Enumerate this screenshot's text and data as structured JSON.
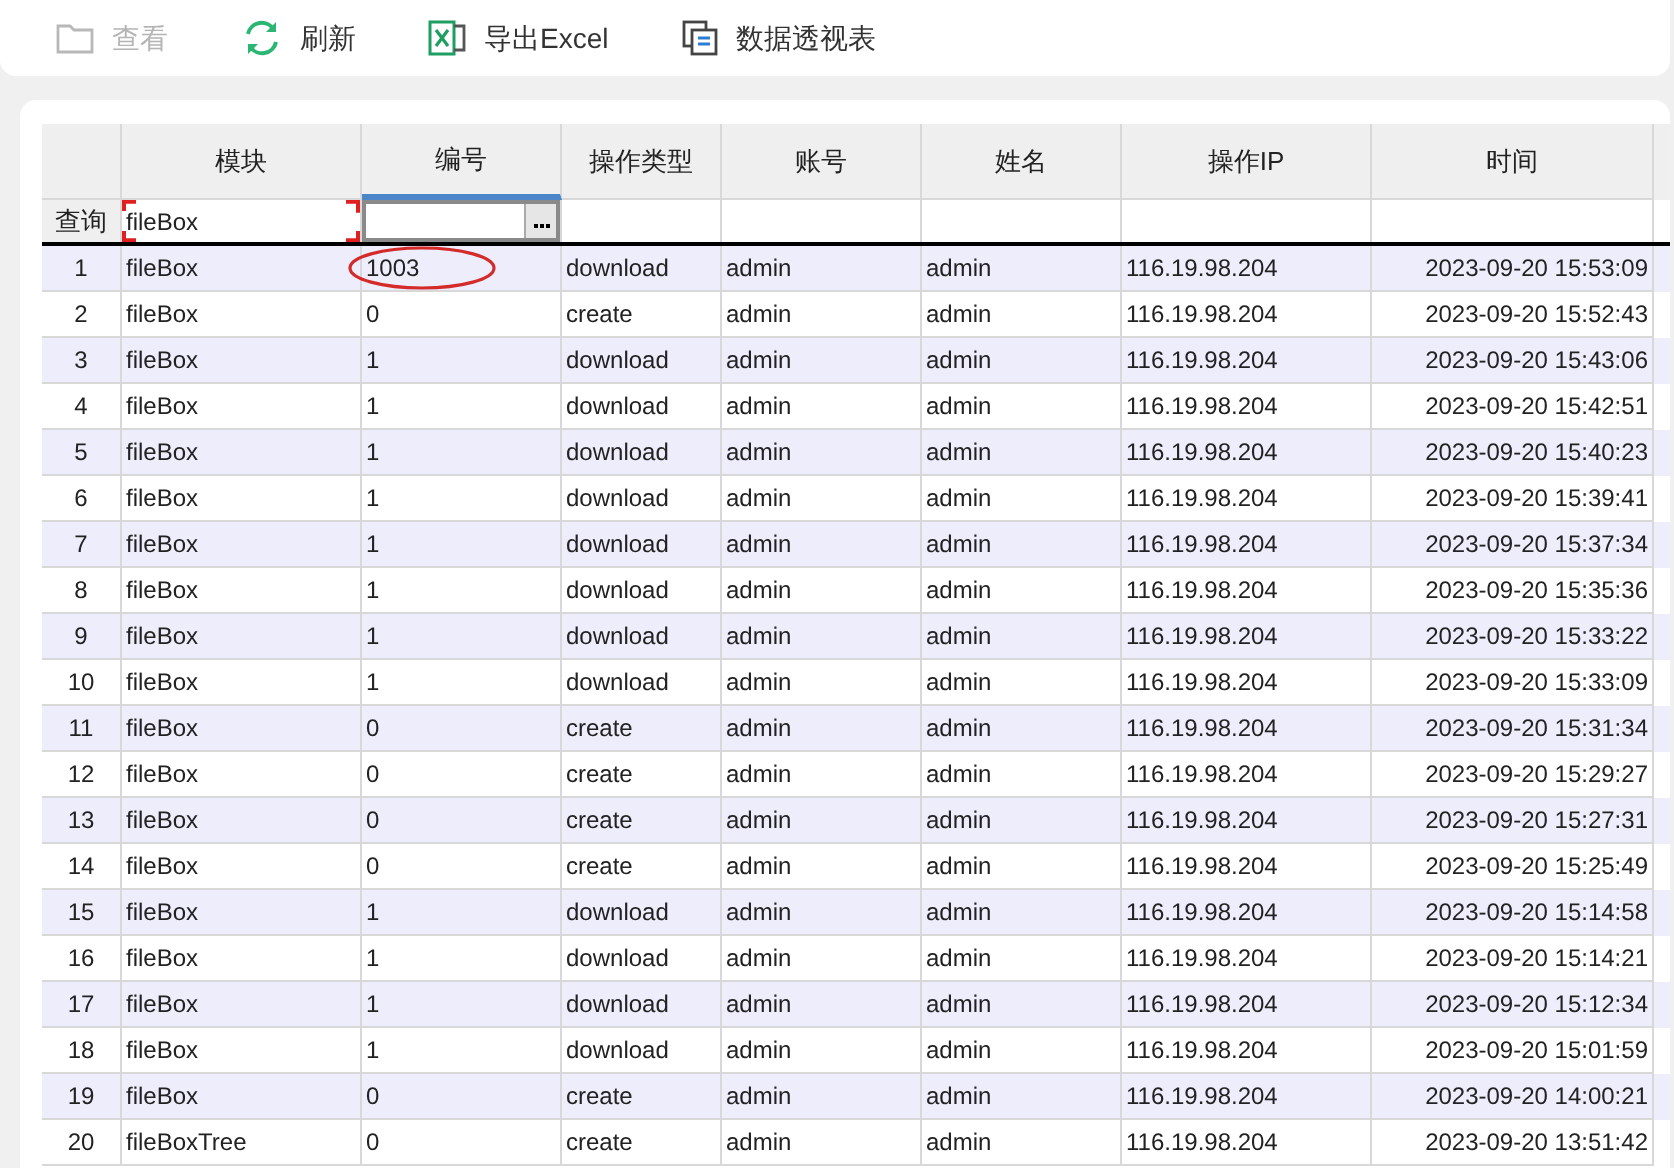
{
  "toolbar": [
    {
      "label": "查看",
      "disabled": true
    },
    {
      "label": "刷新",
      "disabled": false
    },
    {
      "label": "导出Excel",
      "disabled": false
    },
    {
      "label": "数据透视表",
      "disabled": false
    }
  ],
  "table": {
    "columns": [
      {
        "label": "模块",
        "sorted": false
      },
      {
        "label": "编号",
        "sorted": true
      },
      {
        "label": "操作类型",
        "sorted": false
      },
      {
        "label": "账号",
        "sorted": false
      },
      {
        "label": "姓名",
        "sorted": false
      },
      {
        "label": "操作IP",
        "sorted": false
      },
      {
        "label": "时间",
        "sorted": false
      }
    ],
    "filter": {
      "label": "查询",
      "value": "fileBox"
    },
    "rows": [
      {
        "number": "1",
        "cells": [
          "fileBox",
          "1003",
          "download",
          "admin",
          "admin",
          "116.19.98.204",
          "2023-09-20 15:53:09"
        ],
        "circled": true
      },
      {
        "number": "2",
        "cells": [
          "fileBox",
          "0",
          "create",
          "admin",
          "admin",
          "116.19.98.204",
          "2023-09-20 15:52:43"
        ],
        "circled": false
      },
      {
        "number": "3",
        "cells": [
          "fileBox",
          "1",
          "download",
          "admin",
          "admin",
          "116.19.98.204",
          "2023-09-20 15:43:06"
        ],
        "circled": false
      },
      {
        "number": "4",
        "cells": [
          "fileBox",
          "1",
          "download",
          "admin",
          "admin",
          "116.19.98.204",
          "2023-09-20 15:42:51"
        ],
        "circled": false
      },
      {
        "number": "5",
        "cells": [
          "fileBox",
          "1",
          "download",
          "admin",
          "admin",
          "116.19.98.204",
          "2023-09-20 15:40:23"
        ],
        "circled": false
      },
      {
        "number": "6",
        "cells": [
          "fileBox",
          "1",
          "download",
          "admin",
          "admin",
          "116.19.98.204",
          "2023-09-20 15:39:41"
        ],
        "circled": false
      },
      {
        "number": "7",
        "cells": [
          "fileBox",
          "1",
          "download",
          "admin",
          "admin",
          "116.19.98.204",
          "2023-09-20 15:37:34"
        ],
        "circled": false
      },
      {
        "number": "8",
        "cells": [
          "fileBox",
          "1",
          "download",
          "admin",
          "admin",
          "116.19.98.204",
          "2023-09-20 15:35:36"
        ],
        "circled": false
      },
      {
        "number": "9",
        "cells": [
          "fileBox",
          "1",
          "download",
          "admin",
          "admin",
          "116.19.98.204",
          "2023-09-20 15:33:22"
        ],
        "circled": false
      },
      {
        "number": "10",
        "cells": [
          "fileBox",
          "1",
          "download",
          "admin",
          "admin",
          "116.19.98.204",
          "2023-09-20 15:33:09"
        ],
        "circled": false
      },
      {
        "number": "11",
        "cells": [
          "fileBox",
          "0",
          "create",
          "admin",
          "admin",
          "116.19.98.204",
          "2023-09-20 15:31:34"
        ],
        "circled": false
      },
      {
        "number": "12",
        "cells": [
          "fileBox",
          "0",
          "create",
          "admin",
          "admin",
          "116.19.98.204",
          "2023-09-20 15:29:27"
        ],
        "circled": false
      },
      {
        "number": "13",
        "cells": [
          "fileBox",
          "0",
          "create",
          "admin",
          "admin",
          "116.19.98.204",
          "2023-09-20 15:27:31"
        ],
        "circled": false
      },
      {
        "number": "14",
        "cells": [
          "fileBox",
          "0",
          "create",
          "admin",
          "admin",
          "116.19.98.204",
          "2023-09-20 15:25:49"
        ],
        "circled": false
      },
      {
        "number": "15",
        "cells": [
          "fileBox",
          "1",
          "download",
          "admin",
          "admin",
          "116.19.98.204",
          "2023-09-20 15:14:58"
        ],
        "circled": false
      },
      {
        "number": "16",
        "cells": [
          "fileBox",
          "1",
          "download",
          "admin",
          "admin",
          "116.19.98.204",
          "2023-09-20 15:14:21"
        ],
        "circled": false
      },
      {
        "number": "17",
        "cells": [
          "fileBox",
          "1",
          "download",
          "admin",
          "admin",
          "116.19.98.204",
          "2023-09-20 15:12:34"
        ],
        "circled": false
      },
      {
        "number": "18",
        "cells": [
          "fileBox",
          "1",
          "download",
          "admin",
          "admin",
          "116.19.98.204",
          "2023-09-20 15:01:59"
        ],
        "circled": false
      },
      {
        "number": "19",
        "cells": [
          "fileBox",
          "0",
          "create",
          "admin",
          "admin",
          "116.19.98.204",
          "2023-09-20 14:00:21"
        ],
        "circled": false
      },
      {
        "number": "20",
        "cells": [
          "fileBoxTree",
          "0",
          "create",
          "admin",
          "admin",
          "116.19.98.204",
          "2023-09-20 13:51:42"
        ],
        "circled": false
      }
    ]
  }
}
